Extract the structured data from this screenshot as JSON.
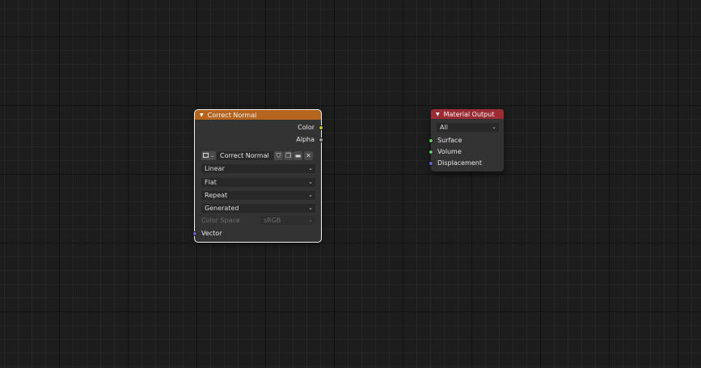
{
  "node_image": {
    "title": "Correct Normal",
    "header_color": "#b5651d",
    "outputs": [
      {
        "label": "Color",
        "socket_color": "#c7c729"
      },
      {
        "label": "Alpha",
        "socket_color": "#a1a1a1"
      }
    ],
    "image_name": "Correct Normal",
    "interpolation": "Linear",
    "projection": "Flat",
    "extension": "Repeat",
    "source": "Generated",
    "color_space_label": "Color Space",
    "color_space_value": "sRGB",
    "inputs": [
      {
        "label": "Vector",
        "socket_color": "#6363c7"
      }
    ],
    "icons": {
      "image_browse": "image-icon",
      "fake_user": "shield-icon",
      "duplicate": "duplicate-icon",
      "open": "folder-icon",
      "unlink": "close-icon"
    }
  },
  "node_output": {
    "title": "Material Output",
    "header_color": "#9b2c33",
    "target": "All",
    "inputs": [
      {
        "label": "Surface",
        "socket_color": "#63c763"
      },
      {
        "label": "Volume",
        "socket_color": "#63c763"
      },
      {
        "label": "Displacement",
        "socket_color": "#6363c7"
      }
    ]
  }
}
